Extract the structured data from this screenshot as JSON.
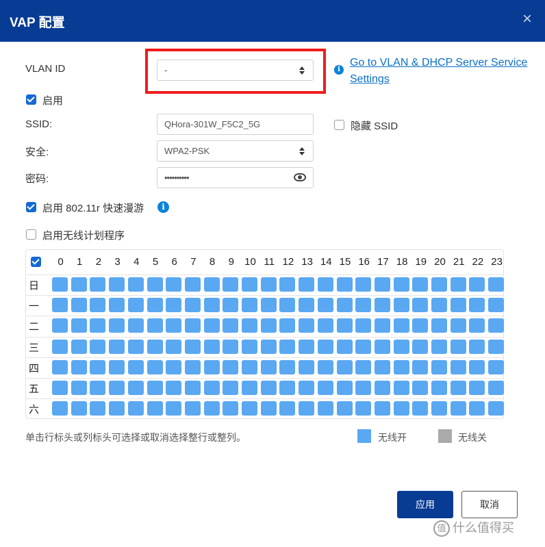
{
  "dialog": {
    "title": "VAP 配置",
    "close_glyph": "×",
    "close_icon": "close-icon"
  },
  "vlan": {
    "label": "VLAN ID",
    "value": "-",
    "info_icon": "i",
    "link_text": "Go to VLAN & DHCP Server Service Settings"
  },
  "enable": {
    "label": "启用",
    "checked": true
  },
  "ssid": {
    "label": "SSID:",
    "value": "QHora-301W_F5C2_5G",
    "hide_label": "隐藏 SSID",
    "hide_checked": false
  },
  "security": {
    "label": "安全:",
    "value": "WPA2-PSK"
  },
  "password": {
    "label": "密码:",
    "value": "••••••••••",
    "eye_icon": "eye-icon"
  },
  "roaming": {
    "label": "启用 802.11r 快速漫游",
    "checked": true,
    "info_icon": "i"
  },
  "schedule": {
    "label": "启用无线计划程序",
    "checked": false,
    "select_all_checked": true,
    "hours": [
      "0",
      "1",
      "2",
      "3",
      "4",
      "5",
      "6",
      "7",
      "8",
      "9",
      "10",
      "11",
      "12",
      "13",
      "14",
      "15",
      "16",
      "17",
      "18",
      "19",
      "20",
      "21",
      "22",
      "23"
    ],
    "days": [
      "日",
      "一",
      "二",
      "三",
      "四",
      "五",
      "六"
    ],
    "all_on": true
  },
  "hint": "单击行标头或列标头可选择或取消选择整行或整列。",
  "legend": {
    "on_label": "无线开",
    "on_color": "#5aa8f2",
    "off_label": "无线关",
    "off_color": "#aaaaaa"
  },
  "buttons": {
    "apply": "应用",
    "cancel": "取消"
  },
  "watermark": {
    "icon_glyph": "值",
    "text": "什么值得买"
  },
  "colors": {
    "header_bg": "#073b94",
    "accent": "#1668d2",
    "link": "#0a70c6",
    "highlight": "#ee1c1c"
  }
}
